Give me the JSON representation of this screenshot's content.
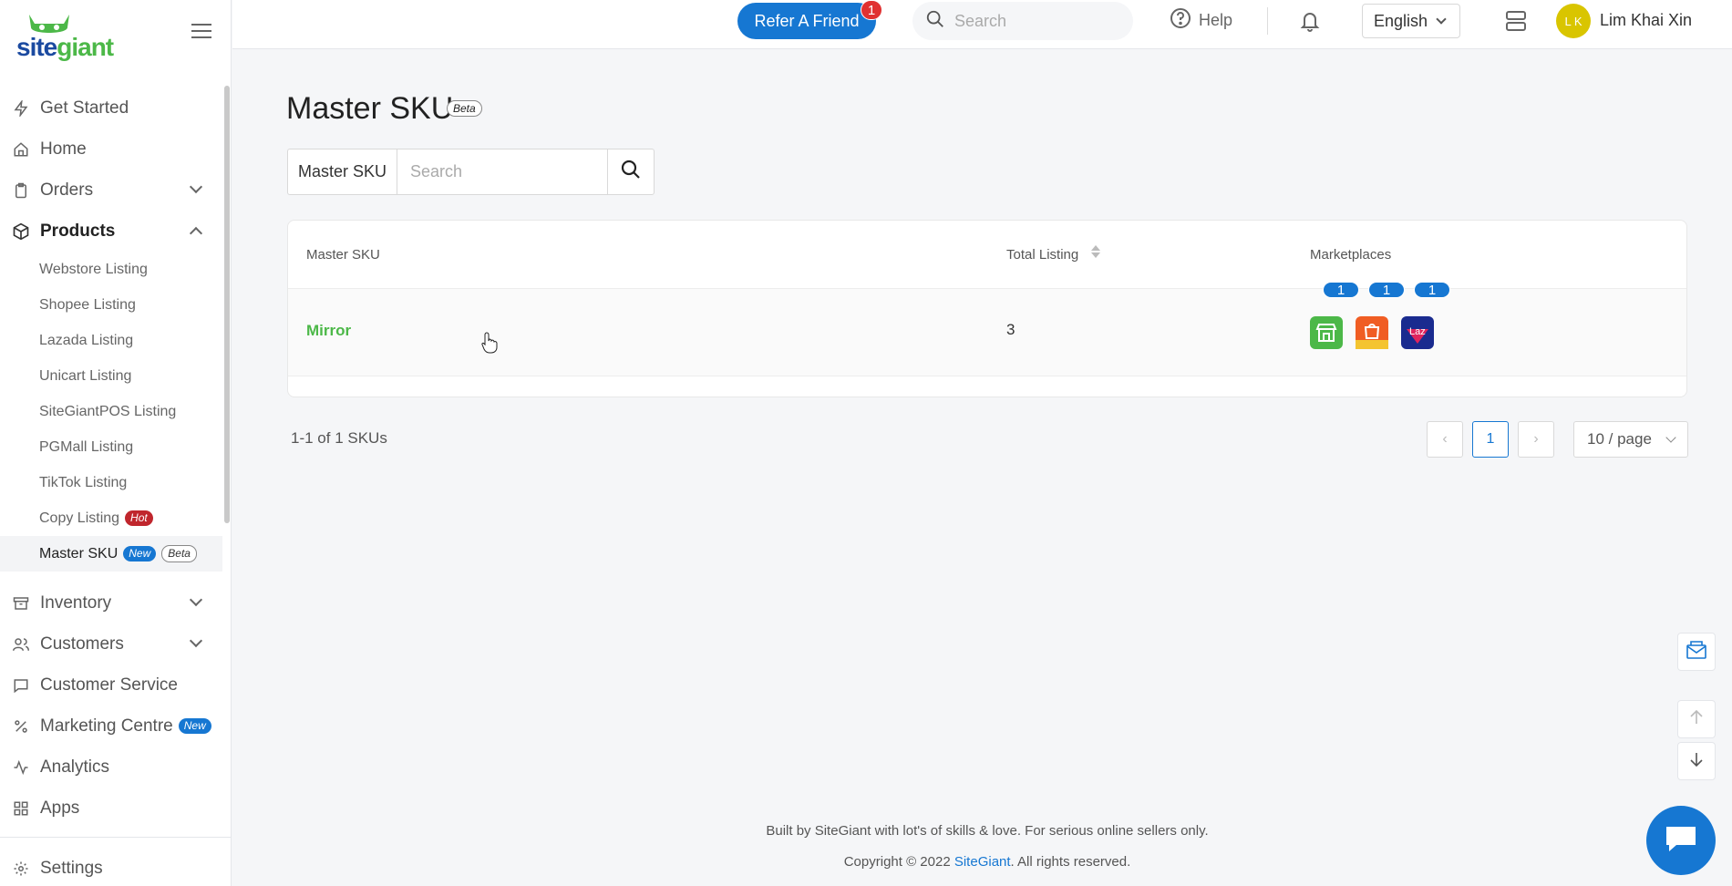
{
  "sidebar": {
    "logo": "sitegiant",
    "items": [
      {
        "label": "Get Started",
        "icon": "bolt-icon"
      },
      {
        "label": "Home",
        "icon": "home-icon"
      },
      {
        "label": "Orders",
        "icon": "clipboard-icon"
      },
      {
        "label": "Products",
        "icon": "box-icon"
      }
    ],
    "products_sub": [
      {
        "label": "Webstore Listing"
      },
      {
        "label": "Shopee Listing"
      },
      {
        "label": "Lazada Listing"
      },
      {
        "label": "Unicart Listing"
      },
      {
        "label": "SiteGiantPOS Listing"
      },
      {
        "label": "PGMall Listing"
      },
      {
        "label": "TikTok Listing"
      },
      {
        "label": "Copy Listing",
        "tag": "Hot"
      },
      {
        "label": "Master SKU",
        "tag": "New",
        "tag2": "Beta"
      }
    ],
    "items_after": [
      {
        "label": "Inventory",
        "icon": "inventory-icon"
      },
      {
        "label": "Customers",
        "icon": "users-icon"
      },
      {
        "label": "Customer Service",
        "icon": "chat-bubble-icon"
      },
      {
        "label": "Marketing Centre",
        "icon": "percent-icon",
        "tag": "New"
      },
      {
        "label": "Analytics",
        "icon": "activity-icon"
      },
      {
        "label": "Apps",
        "icon": "grid-icon"
      }
    ],
    "settings": {
      "label": "Settings",
      "icon": "gear-icon"
    }
  },
  "header": {
    "refer_label": "Refer A Friend",
    "refer_badge": "1",
    "search_placeholder": "Search",
    "help_label": "Help",
    "language": "English",
    "user_initials": "L K",
    "user_name": "Lim Khai Xin"
  },
  "main": {
    "title": "Master SKU",
    "title_tag": "Beta",
    "filter_label": "Master SKU",
    "filter_placeholder": "Search",
    "columns": [
      "Master SKU",
      "Total Listing",
      "Marketplaces"
    ],
    "rows": [
      {
        "sku": "Mirror",
        "total_listing": "3",
        "marketplaces": [
          {
            "name": "webstore",
            "count": "1",
            "color": "#4cb848"
          },
          {
            "name": "shopee",
            "count": "1",
            "color": "#f05d23"
          },
          {
            "name": "lazada",
            "count": "1",
            "color": "#1a2b8f",
            "short": "Laz"
          }
        ]
      }
    ],
    "count_text": "1-1 of 1 SKUs",
    "current_page": "1",
    "per_page": "10 / page"
  },
  "footer": {
    "line1": "Built by SiteGiant with lot's of skills & love. For serious online sellers only.",
    "line2_prefix": "Copyright © 2022 ",
    "line2_link": "SiteGiant",
    "line2_suffix": ". All rights reserved."
  },
  "colors": {
    "brand_blue": "#1677d2",
    "brand_green": "#4cb848",
    "hot_red": "#c0262d"
  }
}
